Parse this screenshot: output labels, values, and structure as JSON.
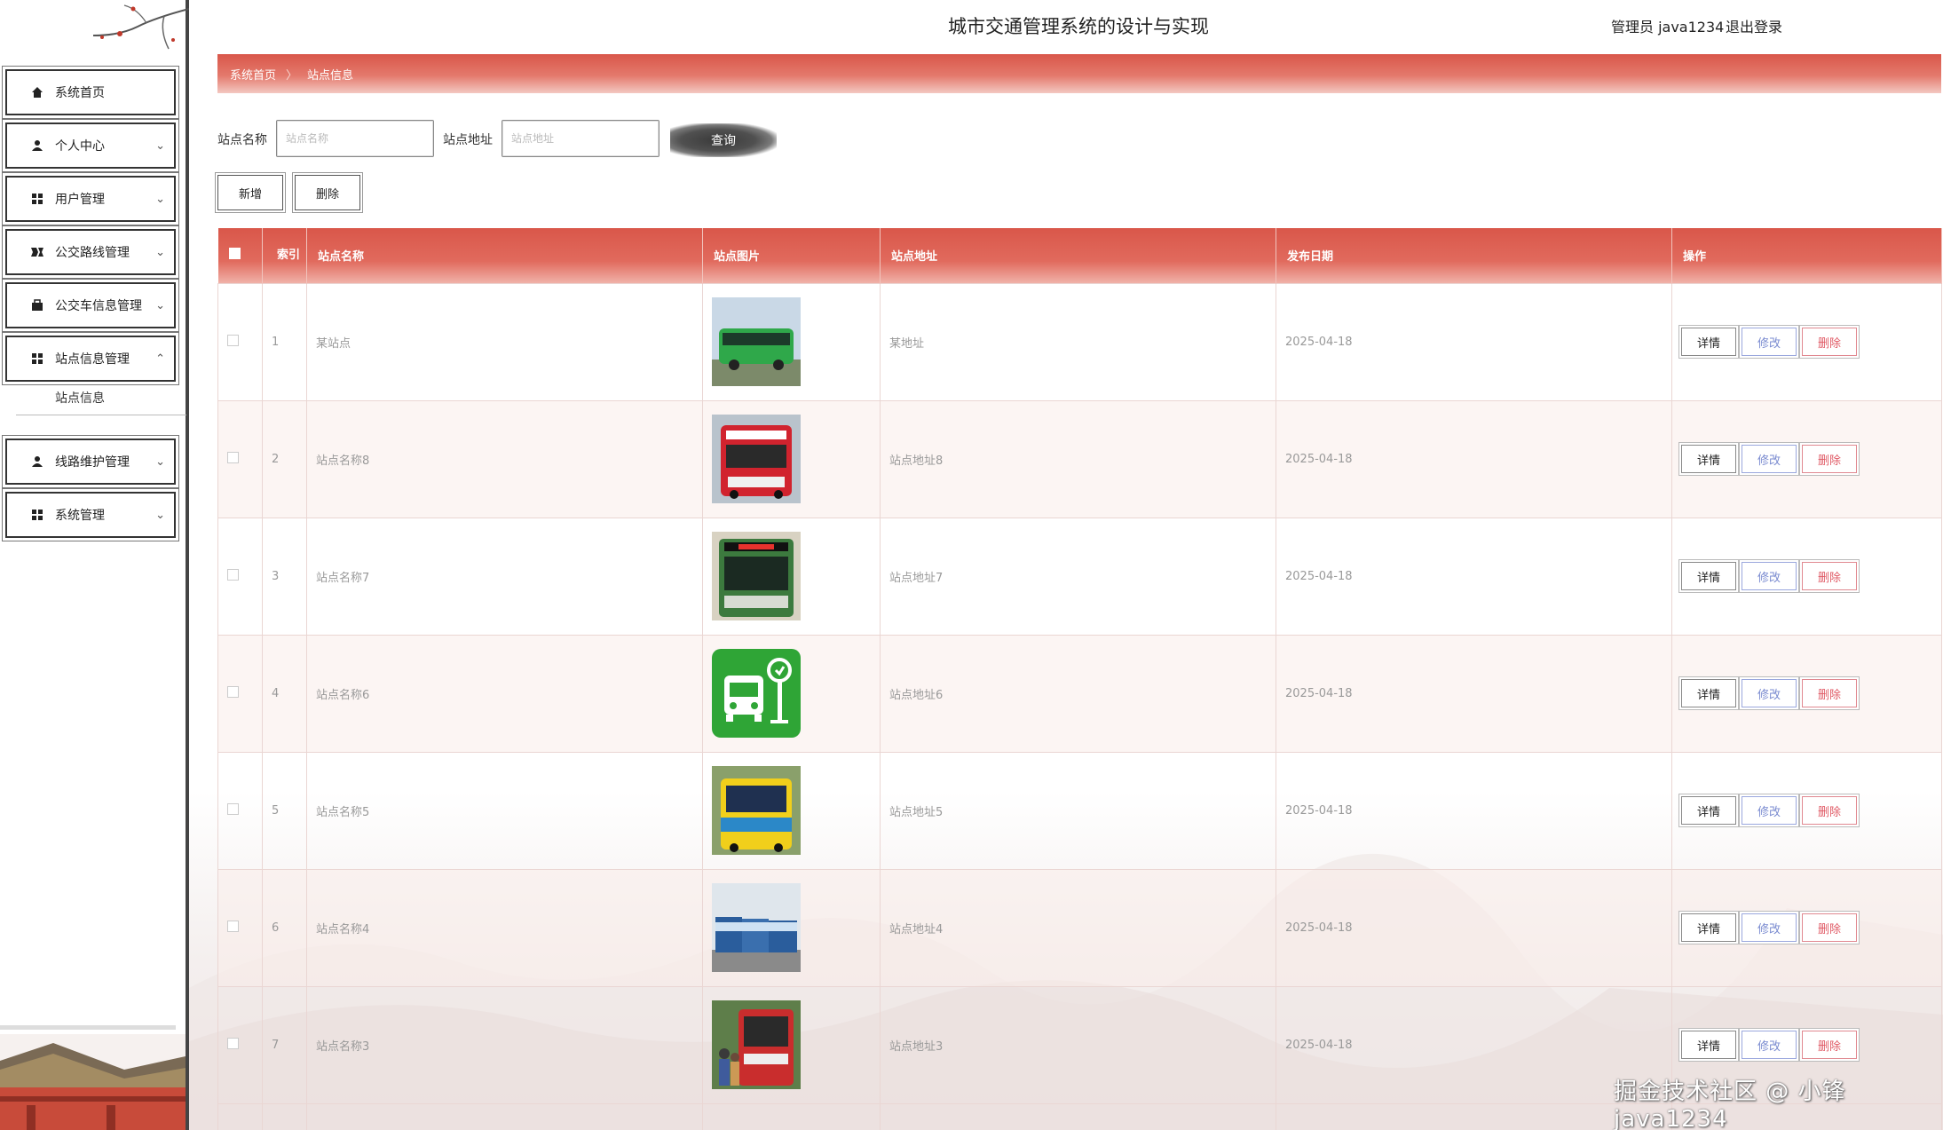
{
  "header": {
    "title": "城市交通管理系统的设计与实现",
    "admin_label": "管理员 java1234",
    "logout_label": "退出登录"
  },
  "sidebar": {
    "items": [
      {
        "label": "系统首页",
        "icon": "home-icon",
        "has_chevron": false
      },
      {
        "label": "个人中心",
        "icon": "user-icon",
        "has_chevron": true
      },
      {
        "label": "用户管理",
        "icon": "grid-icon",
        "has_chevron": true
      },
      {
        "label": "公交路线管理",
        "icon": "route-icon",
        "has_chevron": true
      },
      {
        "label": "公交车信息管理",
        "icon": "briefcase-icon",
        "has_chevron": true
      },
      {
        "label": "站点信息管理",
        "icon": "grid-icon",
        "has_chevron": true,
        "expanded": true
      },
      {
        "label": "线路维护管理",
        "icon": "user-icon",
        "has_chevron": true
      },
      {
        "label": "系统管理",
        "icon": "grid-icon",
        "has_chevron": true
      }
    ],
    "submenu_label": "站点信息"
  },
  "breadcrumb": {
    "home": "系统首页",
    "separator": "〉",
    "current": "站点信息"
  },
  "search": {
    "name_label": "站点名称",
    "name_placeholder": "站点名称",
    "addr_label": "站点地址",
    "addr_placeholder": "站点地址",
    "query_label": "查询"
  },
  "actions": {
    "add_label": "新增",
    "delete_label": "删除"
  },
  "table": {
    "headers": {
      "index": "索引",
      "name": "站点名称",
      "image": "站点图片",
      "address": "站点地址",
      "date": "发布日期",
      "ops": "操作"
    },
    "op_labels": {
      "detail": "详情",
      "edit": "修改",
      "delete": "删除"
    },
    "rows": [
      {
        "index": "1",
        "name": "某站点",
        "image": "green-bus-photo",
        "address": "某地址",
        "date": "2025-04-18"
      },
      {
        "index": "2",
        "name": "站点名称8",
        "image": "red-bus-photo",
        "address": "站点地址8",
        "date": "2025-04-18"
      },
      {
        "index": "3",
        "name": "站点名称7",
        "image": "bus-front-photo",
        "address": "站点地址7",
        "date": "2025-04-18"
      },
      {
        "index": "4",
        "name": "站点名称6",
        "image": "bus-stop-icon",
        "address": "站点地址6",
        "date": "2025-04-18"
      },
      {
        "index": "5",
        "name": "站点名称5",
        "image": "yellow-bus-photo",
        "address": "站点地址5",
        "date": "2025-04-18"
      },
      {
        "index": "6",
        "name": "站点名称4",
        "image": "bus-fleet-photo",
        "address": "站点地址4",
        "date": "2025-04-18"
      },
      {
        "index": "7",
        "name": "站点名称3",
        "image": "passengers-bus-photo",
        "address": "站点地址3",
        "date": "2025-04-18"
      }
    ]
  },
  "watermark": "掘金技术社区 @ 小锋java1234",
  "colors": {
    "accent": "#d9574a",
    "accent_light": "#f3c8c1",
    "delete": "#e05b66",
    "edit": "#7a8bd0"
  }
}
